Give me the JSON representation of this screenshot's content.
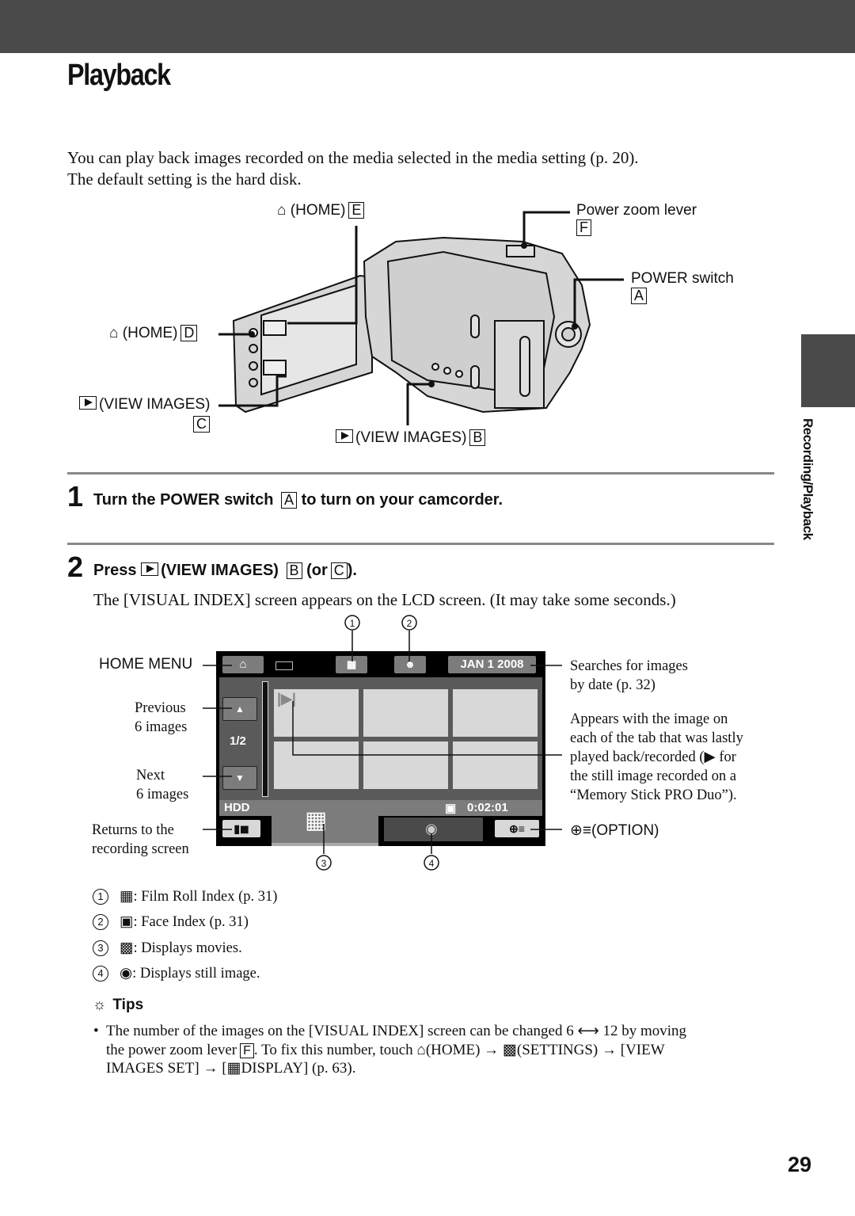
{
  "page": {
    "title": "Playback",
    "intro_lines": [
      "You can play back images recorded on the media selected in the media setting (p. 20).",
      "The default setting is the hard disk."
    ],
    "section_tab": "Recording/Playback",
    "page_number": "29"
  },
  "camera_diagram": {
    "labels": {
      "home_e": {
        "text": "(HOME)",
        "letter": "E"
      },
      "home_d": {
        "text": "(HOME)",
        "letter": "D"
      },
      "view_images_c": {
        "text": "(VIEW IMAGES)",
        "letter": "C"
      },
      "view_images_b": {
        "text": "(VIEW IMAGES)",
        "letter": "B"
      },
      "power_zoom": {
        "text": "Power zoom lever",
        "letter": "F"
      },
      "power_switch": {
        "text": "POWER switch",
        "letter": "A"
      }
    }
  },
  "steps": [
    {
      "number": "1",
      "text_before": "Turn the POWER switch",
      "letter": "A",
      "text_after": "to turn on your camcorder."
    },
    {
      "number": "2",
      "text_press": "Press",
      "text_main": "(VIEW IMAGES)",
      "letter_b": "B",
      "text_or": "(or",
      "letter_c": "C",
      "text_end": ").",
      "description": "The [VISUAL INDEX] screen appears on the LCD screen. (It may take some seconds.)"
    }
  ],
  "lcd_screen": {
    "date": "JAN 1 2008",
    "page_indicator": "1/2",
    "media": "HDD",
    "duration": "0:02:01",
    "callout_numbers": [
      "1",
      "2",
      "3",
      "4"
    ]
  },
  "lcd_callouts": {
    "home_menu": "HOME MENU",
    "previous": [
      "Previous",
      "6 images"
    ],
    "next": [
      "Next",
      "6 images"
    ],
    "returns": [
      "Returns to the",
      "recording screen"
    ],
    "date_search": [
      "Searches for images",
      "by date (p. 32)"
    ],
    "last_played": [
      "Appears with the image on",
      "each of the tab that was lastly",
      "played back/recorded (▶ for",
      "the still image recorded on a",
      "“Memory Stick PRO Duo”)."
    ],
    "option": "(OPTION)"
  },
  "legend": [
    {
      "num": "1",
      "icon": "film-roll-index-icon",
      "text": ": Film Roll Index (p. 31)"
    },
    {
      "num": "2",
      "icon": "face-index-icon",
      "text": ": Face Index (p. 31)"
    },
    {
      "num": "3",
      "icon": "movie-icon",
      "text": ": Displays movies."
    },
    {
      "num": "4",
      "icon": "camera-icon",
      "text": ": Displays still image."
    }
  ],
  "tips": {
    "heading": "Tips",
    "line1": "The number of the images on the [VISUAL INDEX] screen can be changed 6 ⟷ 12 by moving",
    "line2a": "the power zoom lever",
    "line2_letter": "F",
    "line2b": ". To fix this number, touch",
    "home": "(HOME) →",
    "settings": "(SETTINGS) → [VIEW",
    "line3a": "IMAGES SET] → [",
    "line3b": "DISPLAY] (p. 63)."
  }
}
